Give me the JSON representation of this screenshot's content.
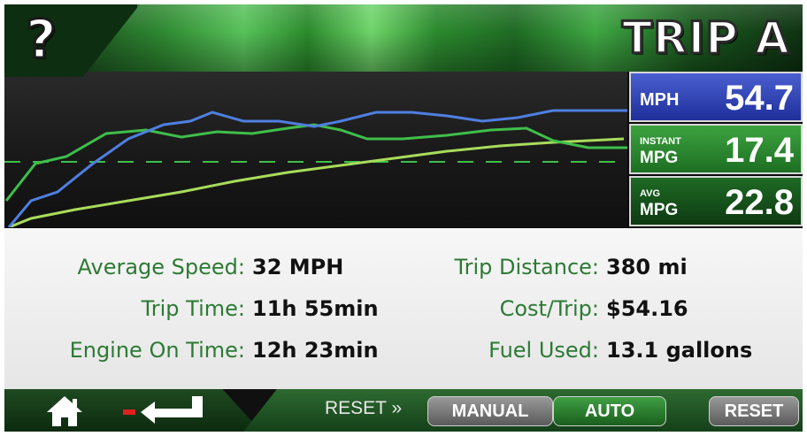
{
  "header": {
    "title": "TRIP A",
    "help_glyph": "?"
  },
  "readouts": {
    "mph": {
      "label": "MPH",
      "value": "54.7"
    },
    "instant": {
      "small": "INSTANT",
      "big": "MPG",
      "value": "17.4"
    },
    "avg": {
      "small": "AVG",
      "big": "MPG",
      "value": "22.8"
    }
  },
  "stats": {
    "average_speed": {
      "label": "Average Speed:",
      "value": "32 MPH"
    },
    "trip_time": {
      "label": "Trip Time:",
      "value": "11h 55min"
    },
    "engine_on_time": {
      "label": "Engine On Time:",
      "value": "12h 23min"
    },
    "trip_distance": {
      "label": "Trip Distance:",
      "value": "380 mi"
    },
    "cost_trip": {
      "label": "Cost/Trip:",
      "value": "$54.16"
    },
    "fuel_used": {
      "label": "Fuel Used:",
      "value": "13.1 gallons"
    }
  },
  "footer": {
    "reset_label": "RESET »",
    "manual_label": "MANUAL",
    "auto_label": "AUTO",
    "reset_button_label": "RESET",
    "home_icon": "home-icon",
    "back_icon": "back-icon"
  },
  "colors": {
    "speed_line": "#4f7fe0",
    "instant_line": "#3fbf4a",
    "avg_line": "#a8dc5a",
    "stat_label": "#2c7a34"
  }
}
